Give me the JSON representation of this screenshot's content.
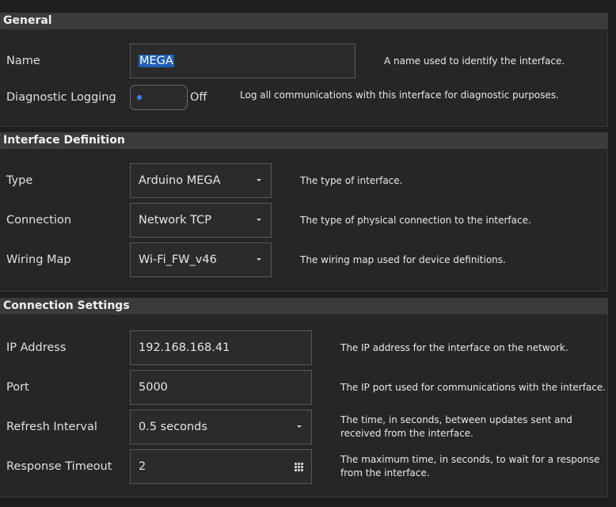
{
  "general": {
    "title": "General",
    "name_label": "Name",
    "name_value": "MEGA",
    "name_desc": "A name used to identify the interface.",
    "logging_label": "Diagnostic Logging",
    "logging_state": "Off",
    "logging_desc": "Log all communications with this interface for diagnostic purposes."
  },
  "interface_definition": {
    "title": "Interface Definition",
    "type_label": "Type",
    "type_value": "Arduino MEGA",
    "type_desc": "The type of interface.",
    "connection_label": "Connection",
    "connection_value": "Network TCP",
    "connection_desc": "The type of physical connection to the interface.",
    "wiring_label": "Wiring Map",
    "wiring_value": "Wi-Fi_FW_v46",
    "wiring_desc": "The wiring map used for device definitions."
  },
  "connection_settings": {
    "title": "Connection Settings",
    "ip_label": "IP Address",
    "ip_value": "192.168.168.41",
    "ip_desc": "The IP address for the interface on the network.",
    "port_label": "Port",
    "port_value": "5000",
    "port_desc": "The IP port used for communications with the interface.",
    "refresh_label": "Refresh Interval",
    "refresh_value": "0.5 seconds",
    "refresh_desc_1": "The time, in seconds, between updates sent and",
    "refresh_desc_2": "received from the interface.",
    "timeout_label": "Response Timeout",
    "timeout_value": "2",
    "timeout_desc_1": "The maximum time, in seconds, to wait for a response",
    "timeout_desc_2": "from the interface."
  },
  "icons": {
    "dropdown": "chevron-down-icon",
    "numeric": "keypad-icon"
  },
  "colors": {
    "selection": "#1e5fb4",
    "toggle_dot": "#2f87ff",
    "header_bg": "#3b3b3b",
    "panel_bg": "#262626"
  }
}
